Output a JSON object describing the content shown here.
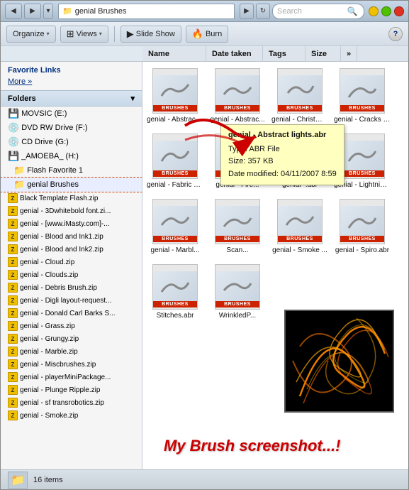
{
  "window": {
    "title": "genial Brushes",
    "address": "genial Brushes"
  },
  "controls": {
    "minimize": "–",
    "maximize": "□",
    "close": "×",
    "back_title": "←",
    "forward_title": "→",
    "recent_title": "▾",
    "search_placeholder": "Search",
    "help": "?"
  },
  "toolbar": {
    "organize": "Organize",
    "views": "Views",
    "slideshow": "Slide Show",
    "burn": "Burn"
  },
  "columns": {
    "name": "Name",
    "date_taken": "Date taken",
    "tags": "Tags",
    "size": "Size",
    "more": "»"
  },
  "sidebar": {
    "favorite_links": "Favorite Links",
    "more": "More »",
    "folders": "Folders",
    "items": [
      {
        "type": "drive",
        "label": "MOVSIC (E:)"
      },
      {
        "type": "drive",
        "label": "DVD RW Drive (F:)"
      },
      {
        "type": "drive",
        "label": "CD Drive (G:)"
      },
      {
        "type": "drive",
        "label": "_AMOEBA_ (H:)"
      },
      {
        "type": "folder",
        "label": "Flash Favorite 1",
        "sub": true
      },
      {
        "type": "folder",
        "label": "genial Brushes",
        "selected": true,
        "sub": true
      }
    ],
    "zip_items": [
      "Black Template Flash.zip",
      "genial - 3Dwhitebold font.zi...",
      "genial - [www.iMasty.com]-...",
      "genial - Blood and Ink1.zip",
      "genial - Blood and Ink2.zip",
      "genial - Cloud.zip",
      "genial - Clouds.zip",
      "genial - Debris Brush.zip",
      "genial - Digli layout-request...",
      "genial - Donald Carl Barks S...",
      "genial - Grass.zip",
      "genial - Grungy.zip",
      "genial - Marble.zip",
      "genial - Miscbrushes.zip",
      "genial - playerMiniPackage...",
      "genial - Plunge Ripple.zip",
      "genial - sf transrobotics.zip",
      "genial - Smoke.zip"
    ]
  },
  "files": [
    {
      "label": "genial - Abstract.abr",
      "brushes": "BRUSHES"
    },
    {
      "label": "genial - Abstrac...",
      "brushes": "BRUSHES"
    },
    {
      "label": "genial - Christmast...",
      "brushes": "BRUSHES"
    },
    {
      "label": "genial - Cracks an...",
      "brushes": "BRUSHES"
    },
    {
      "label": "genial - Fabric Te...",
      "brushes": "BRUSHES"
    },
    {
      "label": "genial - Fire...",
      "brushes": "BRUSHES"
    },
    {
      "label": "genial -.abr",
      "brushes": "BRUSHES"
    },
    {
      "label": "genial - Lightning.abr",
      "brushes": "BRUSHES"
    },
    {
      "label": "genial - Marbl...",
      "brushes": "BRUSHES"
    },
    {
      "label": "Scan...",
      "brushes": "BRUSHES"
    },
    {
      "label": "genial - Smoke ...",
      "brushes": "BRUSHES"
    },
    {
      "label": "genial - Spiro.abr",
      "brushes": "BRUSHES"
    },
    {
      "label": "Stitches.abr",
      "brushes": "BRUSHES"
    },
    {
      "label": "WrinkledP...",
      "brushes": "BRUSHES"
    }
  ],
  "tooltip": {
    "filename": "genial - Abstract lights.abr",
    "type_label": "Type:",
    "type_value": "ABR File",
    "size_label": "Size:",
    "size_value": "357 KB",
    "date_label": "Date modified:",
    "date_value": "04/11/2007 8:59"
  },
  "screenshot_text": "My Brush screenshot...!",
  "status": {
    "item_count": "16 items"
  }
}
